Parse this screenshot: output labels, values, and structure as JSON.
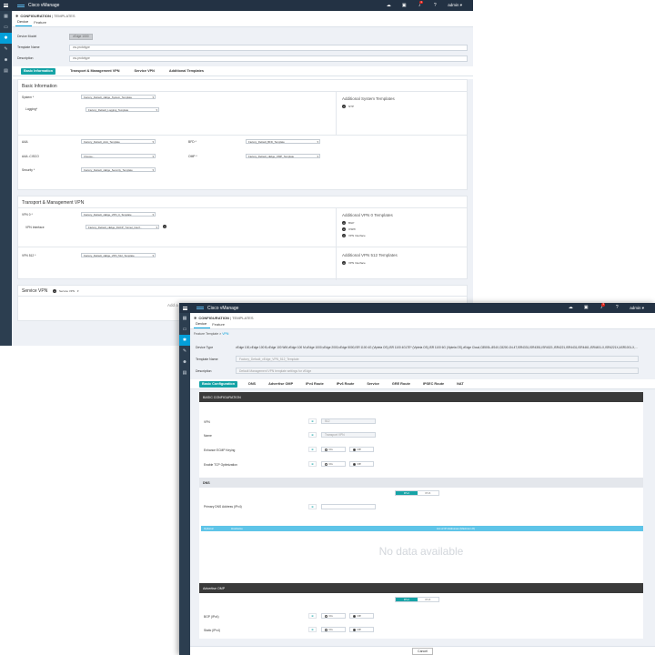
{
  "app": {
    "title": "Cisco vManage",
    "user": "admin",
    "bell_count": "1"
  },
  "w1": {
    "crumb_main": "CONFIGURATION",
    "crumb_sub": "TEMPLATES",
    "tabs": [
      "Device",
      "Feature"
    ],
    "device_model_label": "Device Model",
    "device_model_value": "vEdge 1000",
    "template_name_label": "Template Name",
    "template_name_value": "cw-prototype",
    "description_label": "Description",
    "description_value": "cw-prototype",
    "subtabs": [
      "Basic Information",
      "Transport & Management VPN",
      "Service VPN",
      "Additional Templates"
    ],
    "basic": {
      "title": "Basic Information",
      "system_label": "System *",
      "system_value": "Factory_Default_vEdge_System_Template",
      "logging_label": "Logging*",
      "logging_value": "Factory_Default_Logging_Template",
      "aaa_label": "AAA",
      "aaa_value": "Factory_Default_AAA_Template",
      "bfd_label": "BFD *",
      "bfd_value": "Factory_Default_BFD_Template",
      "aaacisco_label": "AAA -CISCO",
      "aaacisco_value": "Choose...",
      "omp_label": "OMP *",
      "omp_value": "Factory_Default_vEdge_OMP_Template",
      "security_label": "Security *",
      "security_value": "Factory_Default_vEdge_Security_Template",
      "side_title": "Additional System Templates",
      "side_items": [
        "NTP"
      ]
    },
    "transport": {
      "title": "Transport & Management VPN",
      "vpn0_label": "VPN 0 *",
      "vpn0_value": "Factory_Default_vEdge_VPN_0_Template",
      "vpnif_label": "VPN Interface",
      "vpnif_value": "Factory_Default_vEdge_DHCP_Tunnel_Interf...",
      "side_title": "Additional VPN 0 Templates",
      "side_items": [
        "BGP",
        "OSPF",
        "VPN Interface"
      ],
      "vpn512_label": "VPN 512 *",
      "vpn512_value": "Factory_Default_vEdge_VPN_512_Template",
      "side512_title": "Additional VPN 512 Templates",
      "side512_items": [
        "VPN Interface"
      ]
    },
    "service": {
      "title": "Service VPN",
      "add_label": "Service VPN",
      "add_text": "Add a V"
    }
  },
  "w2": {
    "crumb_main": "CONFIGURATION",
    "crumb_sub": "TEMPLATES",
    "tabs": [
      "Device",
      "Feature"
    ],
    "sub_crumb_1": "Feature Template",
    "sub_crumb_2": "VPN",
    "device_type_label": "Device Type",
    "device_type_value": "vEdge 100,vEdge 100 B,vEdge 100 WM,vEdge 100 M,vEdge 1000,vEdge 2000,vEdge 5000,ISR 1100 4G (Viptela OS),ISR 1100 4GLTE* (Viptela OS),ISR 1100 6G (Viptela OS),vEdge Cloud,C8500L-8S4X,C8200-1N-4T,ISR4331,ISR4351,ISR4321,ISR4221,ISR4431,ISR4461,ISR4451-X,ISR4221X,ASR1001-X,ASR1002-X,ASR1001-HX,ASR1002-HX,CSR1000v,C1111-8PLTEEA",
    "template_name_label": "Template Name",
    "template_name_value": "Factory_Default_vEdge_VPN_512_Template",
    "description_label": "Description",
    "description_value": "Default Management VPN template settings for vEdge",
    "subtabs": [
      "Basic Configuration",
      "DNS",
      "Advertise OMP",
      "IPv4 Route",
      "IPv6 Route",
      "Service",
      "GRE Route",
      "IPSEC Route",
      "NAT"
    ],
    "basic_title": "BASIC CONFIGURATION",
    "vpn_label": "VPN",
    "vpn_value": "512",
    "name_label": "Name",
    "name_value": "Transport VPN",
    "ecmp_label": "Enhance ECMP Keying",
    "tcp_label": "Enable TCP Optimization",
    "on_label": "On",
    "off_label": "Off",
    "dns_title": "DNS",
    "ipv4_label": "IPv4",
    "ipv6_label": "IPv6",
    "primary_dns_label": "Primary DNS Address (IPv4)",
    "table_headers": [
      "Optional",
      "Hostname",
      "List of IP Addresses (Maximum 8)"
    ],
    "nodata": "No data available",
    "adv_title": "Advertise OMP",
    "bgp_label": "BGP (IPv4)",
    "static_label": "Static (IPv4)",
    "cancel_label": "Cancel"
  }
}
